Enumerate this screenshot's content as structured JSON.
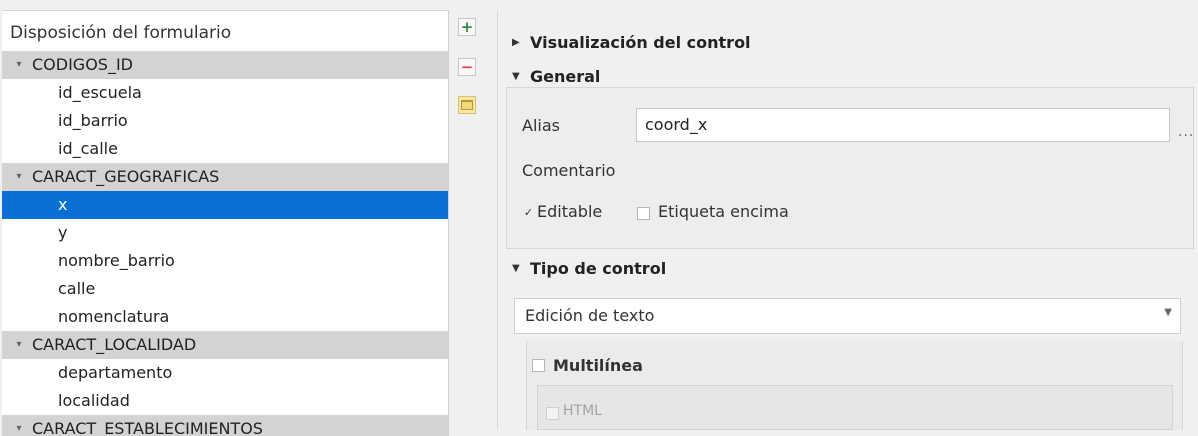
{
  "layout_tree": {
    "header": "Disposición del formulario",
    "rows": [
      {
        "type": "group",
        "label": "CODIGOS_ID",
        "expanded": true
      },
      {
        "type": "item",
        "label": "id_escuela"
      },
      {
        "type": "item",
        "label": "id_barrio"
      },
      {
        "type": "item",
        "label": "id_calle"
      },
      {
        "type": "group",
        "label": "CARACT_GEOGRAFICAS",
        "expanded": true
      },
      {
        "type": "item",
        "label": "x",
        "selected": true
      },
      {
        "type": "item",
        "label": "y"
      },
      {
        "type": "item",
        "label": "nombre_barrio"
      },
      {
        "type": "item",
        "label": "calle"
      },
      {
        "type": "item",
        "label": "nomenclatura"
      },
      {
        "type": "group",
        "label": "CARACT_LOCALIDAD",
        "expanded": true
      },
      {
        "type": "item",
        "label": "departamento"
      },
      {
        "type": "item",
        "label": "localidad"
      },
      {
        "type": "group",
        "label": "CARACT_ESTABLECIMIENTOS",
        "expanded": true
      }
    ]
  },
  "toolbar": {
    "add_icon": "plus-icon",
    "remove_icon": "minus-icon",
    "folder_icon": "folder-icon"
  },
  "widget_display": {
    "title": "Visualización del control",
    "expanded": false
  },
  "general": {
    "title": "General",
    "alias_label": "Alias",
    "alias_value": "coord_x",
    "more_button": "...",
    "comment_label": "Comentario",
    "editable_label": "Editable",
    "editable_checked": true,
    "label_on_top": "Etiqueta encima",
    "label_on_top_checked": false
  },
  "widget_type": {
    "title": "Tipo de control",
    "selected": "Edición de texto",
    "multiline_label": "Multilínea",
    "multiline_checked": false,
    "html_label": "HTML",
    "html_checked": false
  },
  "colors": {
    "selection": "#0a6fd2",
    "group_row": "#d3d3d3",
    "panel": "#f0f0f0"
  }
}
